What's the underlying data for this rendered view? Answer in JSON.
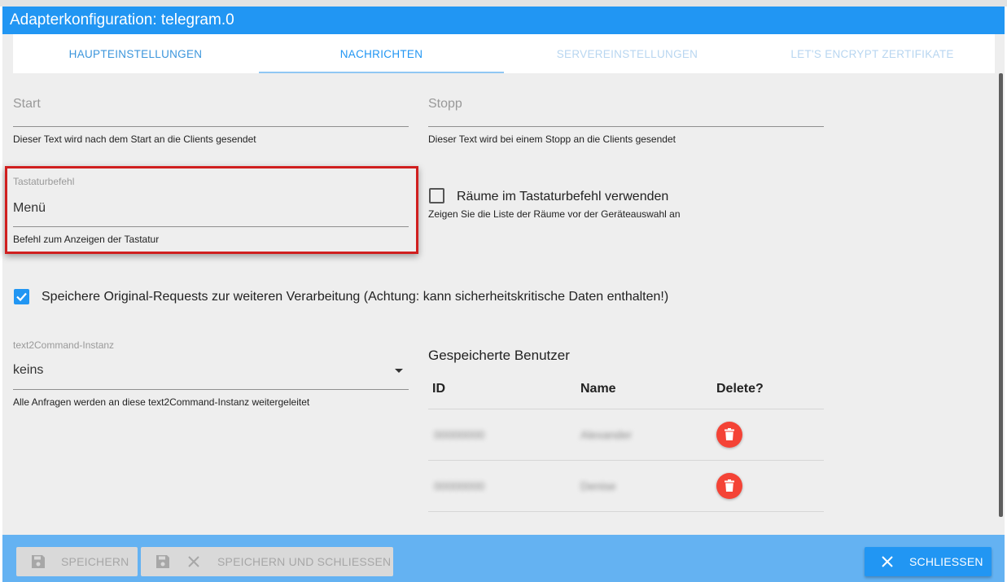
{
  "window": {
    "title": "Adapterkonfiguration: telegram.0"
  },
  "tabs": [
    {
      "label": "HAUPTEINSTELLUNGEN"
    },
    {
      "label": "NACHRICHTEN"
    },
    {
      "label": "SERVEREINSTELLUNGEN"
    },
    {
      "label": "LET'S ENCRYPT ZERTIFIKATE"
    }
  ],
  "start": {
    "placeholder": "Start",
    "helper": "Dieser Text wird nach dem Start an die Clients gesendet"
  },
  "stop": {
    "placeholder": "Stopp",
    "helper": "Dieser Text wird bei einem Stopp an die Clients gesendet"
  },
  "keyboard": {
    "label": "Tastaturbefehl",
    "value": "Menü",
    "helper": "Befehl zum Anzeigen der Tastatur"
  },
  "rooms": {
    "label": "Räume im Tastaturbefehl verwenden",
    "helper": "Zeigen Sie die Liste der Räume vor der Geräteauswahl an",
    "checked": false
  },
  "save_raw": {
    "label": "Speichere Original-Requests zur weiteren Verarbeitung (Achtung: kann sicherheitskritische Daten enthalten!)",
    "checked": true
  },
  "text2command": {
    "label": "text2Command-Instanz",
    "value": "keins",
    "helper": "Alle Anfragen werden an diese text2Command-Instanz weitergeleitet"
  },
  "users": {
    "title": "Gespeicherte Benutzer",
    "columns": {
      "id": "ID",
      "name": "Name",
      "delete": "Delete?"
    },
    "rows": [
      {
        "id": "00000000",
        "name": "Alexander"
      },
      {
        "id": "00000000",
        "name": "Denise"
      }
    ]
  },
  "footer": {
    "save_label": "SPEICHERN",
    "save_close_label": "SPEICHERN UND SCHLIESSEN",
    "close_label": "SCHLIESSEN"
  },
  "colors": {
    "primary": "#2196f3",
    "delete": "#f44336",
    "highlight": "#d01f1f"
  }
}
